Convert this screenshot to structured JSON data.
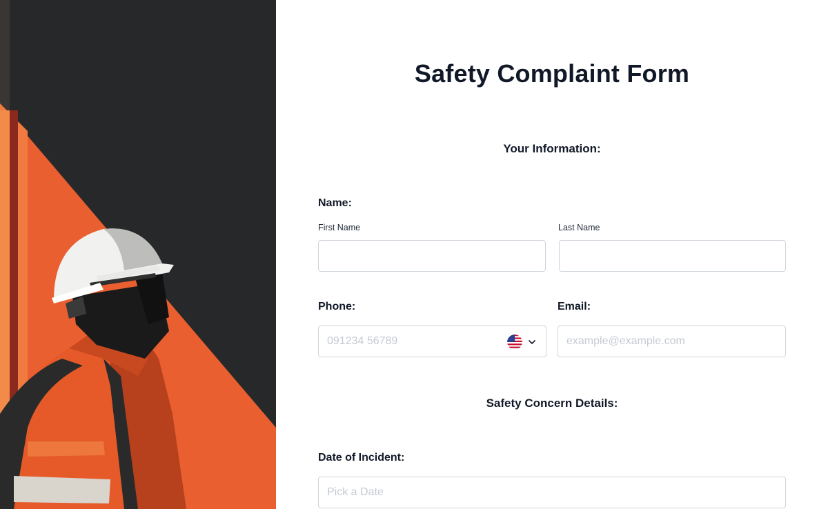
{
  "form": {
    "title": "Safety Complaint Form",
    "your_info_heading": "Your Information:",
    "name_label": "Name:",
    "first_name_label": "First Name",
    "first_name_value": "",
    "last_name_label": "Last Name",
    "last_name_value": "",
    "phone_label": "Phone:",
    "phone_placeholder": "091234 56789",
    "phone_value": "",
    "phone_country_icon": "us-flag-icon",
    "email_label": "Email:",
    "email_placeholder": "example@example.com",
    "email_value": "",
    "concern_heading": "Safety Concern Details:",
    "date_label": "Date of Incident:",
    "date_placeholder": "Pick a Date",
    "date_value": ""
  },
  "illustration": {
    "subject": "construction-worker-illustration",
    "colors": {
      "dark": "#262829",
      "orange": "#ea5f30",
      "white": "#f2f2f2"
    }
  }
}
